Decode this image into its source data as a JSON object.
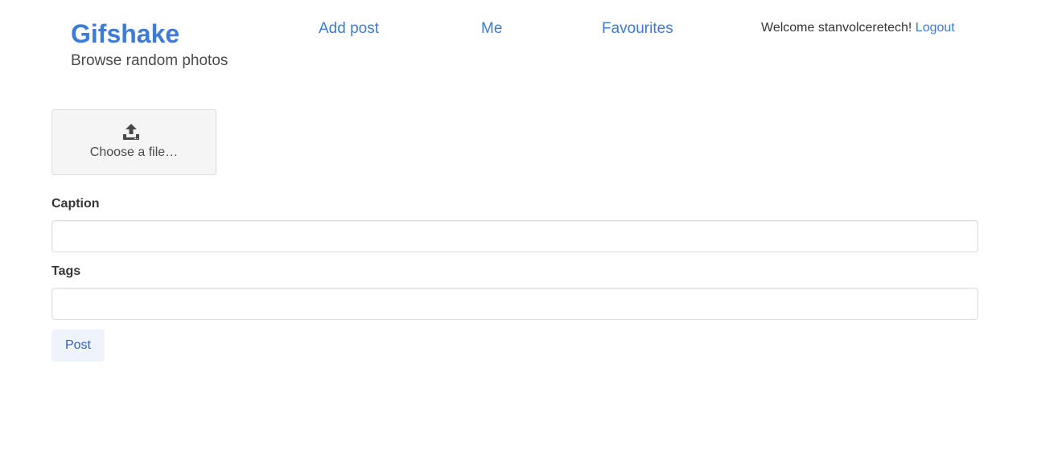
{
  "header": {
    "brand_title": "Gifshake",
    "brand_subtitle": "Browse random photos",
    "nav": {
      "add_post": "Add post",
      "me": "Me",
      "favourites": "Favourites"
    },
    "welcome_text": "Welcome stanvolceretech!",
    "logout_label": "Logout"
  },
  "form": {
    "file_upload": {
      "label": "Choose a file…",
      "icon": "upload-icon"
    },
    "caption": {
      "label": "Caption",
      "value": ""
    },
    "tags": {
      "label": "Tags",
      "value": ""
    },
    "submit_label": "Post"
  },
  "colors": {
    "link": "#3e7bd6",
    "button_bg": "#eef3fc",
    "button_text": "#3660b8",
    "file_box_bg": "#f5f5f5"
  }
}
